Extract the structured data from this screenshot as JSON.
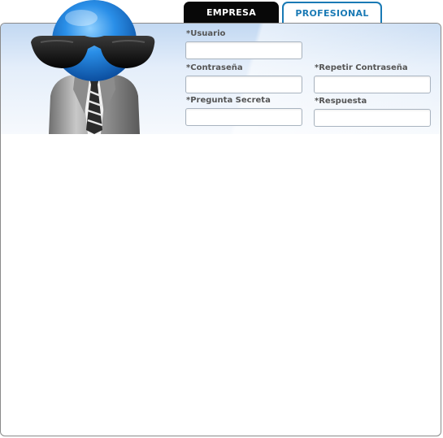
{
  "tabs": [
    {
      "label": "EMPRESA",
      "active": true
    },
    {
      "label": "PROFESIONAL",
      "active": false
    }
  ],
  "form": {
    "usuario": {
      "label": "*Usuario",
      "value": ""
    },
    "contrasena": {
      "label": "*Contraseña",
      "value": ""
    },
    "repetir_contrasena": {
      "label": "*Repetir Contraseña",
      "value": ""
    },
    "pregunta_secreta": {
      "label": "*Pregunta Secreta",
      "value": ""
    },
    "respuesta": {
      "label": "*Respuesta",
      "value": ""
    }
  },
  "colors": {
    "tab_active_bg": "#080808",
    "tab_inactive_text": "#1a7ab5",
    "mascot_head": "#2a8fe8",
    "label_text": "#555555"
  },
  "icons": {
    "mascot": "blue-agent-with-sunglasses-mascot"
  }
}
